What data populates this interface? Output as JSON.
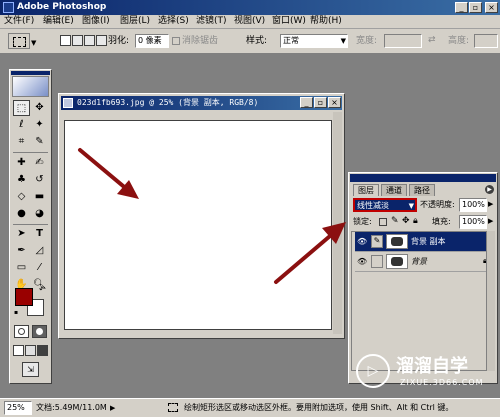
{
  "app": {
    "title": "Adobe Photoshop"
  },
  "menu": [
    "文件(F)",
    "编辑(E)",
    "图像(I)",
    "图层(L)",
    "选择(S)",
    "滤镜(T)",
    "视图(V)",
    "窗口(W)",
    "帮助(H)"
  ],
  "options": {
    "feather_label": "羽化:",
    "feather_value": "0 像素",
    "antialias_label": "消除锯齿",
    "style_label": "样式:",
    "style_value": "正常",
    "width_label": "宽度:",
    "height_label": "高度:"
  },
  "document": {
    "title": "023d1fb693.jpg @ 25% (背景 副本, RGB/8)"
  },
  "layers_palette": {
    "tabs": [
      "图层",
      "通道",
      "路径"
    ],
    "blend_mode": "线性减淡",
    "opacity_label": "不透明度:",
    "opacity_value": "100%",
    "lock_label": "锁定:",
    "fill_label": "填充:",
    "fill_value": "100%",
    "layers": [
      {
        "name": "背景 副本",
        "selected": true
      },
      {
        "name": "背景",
        "selected": false
      }
    ]
  },
  "status": {
    "zoom": "25%",
    "doc_size": "文档:5.49M/11.0M",
    "hint": "绘制矩形选区或移动选区外框。要用附加选项，使用 Shift、Alt 和 Ctrl 键。"
  },
  "colors": {
    "foreground": "#990000",
    "background": "#ffffff",
    "arrow": "#8b1010",
    "highlight_box": "#c00000",
    "title_bar": "#0a246a"
  },
  "watermark": {
    "brand": "溜溜自学",
    "url": "ZIXUE.3D66.COM"
  }
}
